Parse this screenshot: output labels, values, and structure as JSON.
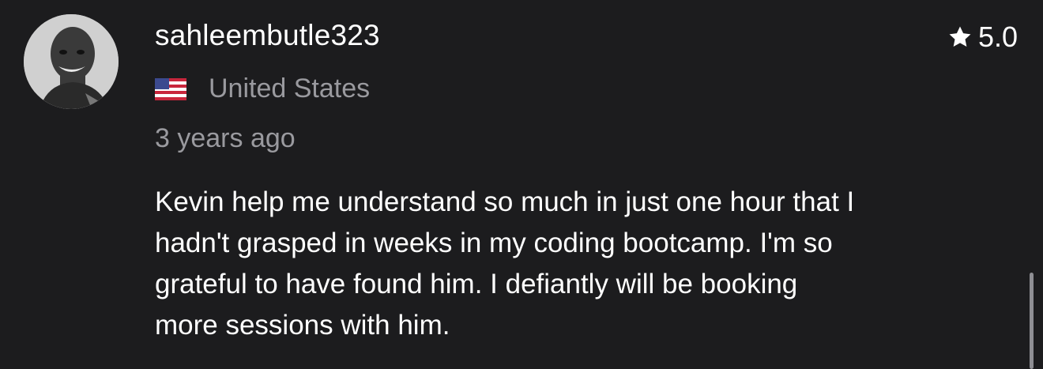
{
  "review": {
    "username": "sahleembutle323",
    "rating": "5.0",
    "country": "United States",
    "time_ago": "3 years ago",
    "text": "Kevin help me understand so much in just one hour that I\nhadn't grasped in weeks in my coding bootcamp.  I'm so\ngrateful to have found him. I defiantly will be booking\nmore sessions with him."
  },
  "icons": {
    "rating": "star-icon",
    "country": "us-flag-icon"
  },
  "colors": {
    "background": "#1c1c1e",
    "primary_text": "#ffffff",
    "secondary_text": "#9a9a9f"
  }
}
